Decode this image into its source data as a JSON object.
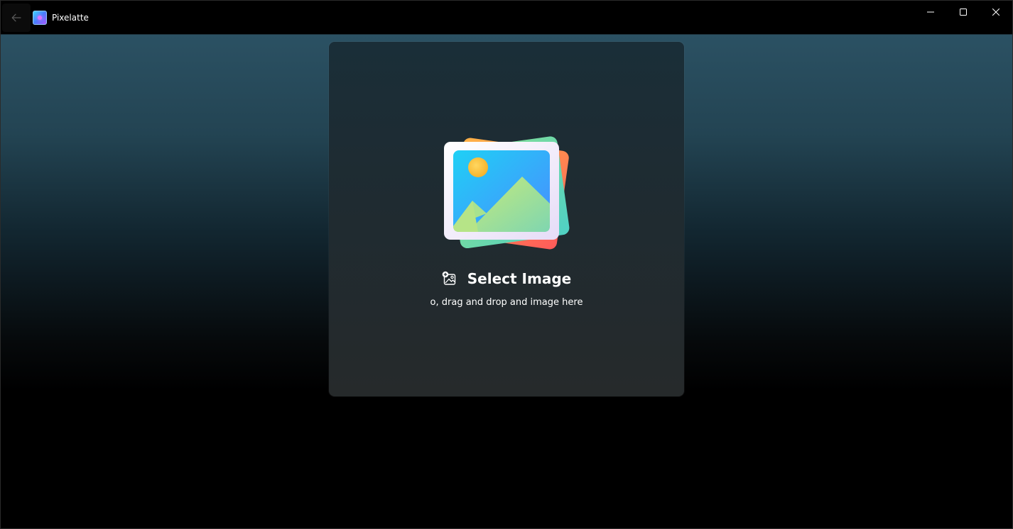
{
  "window": {
    "app_title": "Pixelatte",
    "back_icon": "arrow-left-icon",
    "app_icon": "pixelatte-logo-icon",
    "caption": {
      "minimize_icon": "minimize-icon",
      "maximize_icon": "maximize-icon",
      "close_icon": "close-icon"
    }
  },
  "main": {
    "hero_icon": "image-gallery-icon",
    "select_button": {
      "icon": "image-add-icon",
      "label": "Select Image"
    },
    "hint": "o, drag and drop and image here"
  },
  "colors": {
    "background_top": "#2b5163",
    "background_bottom": "#000000",
    "card": "#1f2b31",
    "text": "#ffffff"
  }
}
